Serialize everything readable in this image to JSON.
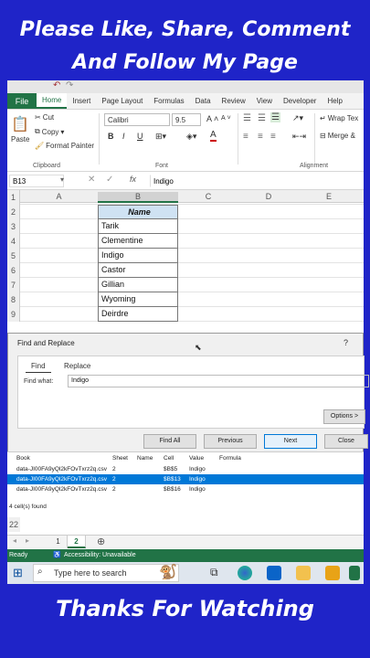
{
  "banner": {
    "line1": "Please Like, Share, Comment",
    "line2": "And Follow My Page",
    "bottom": "Thanks For Watching"
  },
  "ribbon": {
    "tabs": [
      "File",
      "Home",
      "Insert",
      "Page Layout",
      "Formulas",
      "Data",
      "Review",
      "View",
      "Developer",
      "Help"
    ],
    "clipboard": {
      "paste": "Paste",
      "cut": "Cut",
      "copy": "Copy",
      "format_painter": "Format Painter",
      "label": "Clipboard"
    },
    "font": {
      "name": "Calibri",
      "size": "9.5",
      "grow": "A",
      "shrink": "A",
      "bold": "B",
      "italic": "I",
      "underline": "U",
      "label": "Font"
    },
    "alignment": {
      "wrap": "Wrap Tex",
      "merge": "Merge &",
      "label": "Alignment"
    }
  },
  "formula_bar": {
    "name_box": "B13",
    "fx": "fx",
    "value": "Indigo"
  },
  "columns": [
    "A",
    "B",
    "C",
    "D",
    "E"
  ],
  "rows": [
    {
      "num": "1",
      "b": ""
    },
    {
      "num": "2",
      "b": "Name"
    },
    {
      "num": "3",
      "b": "Tarik"
    },
    {
      "num": "4",
      "b": "Clementine"
    },
    {
      "num": "5",
      "b": "Indigo"
    },
    {
      "num": "6",
      "b": "Castor"
    },
    {
      "num": "7",
      "b": "Gillian"
    },
    {
      "num": "8",
      "b": "Wyoming"
    },
    {
      "num": "9",
      "b": "Deirdre"
    }
  ],
  "dialog": {
    "title": "Find and Replace",
    "help": "?",
    "tab_find": "Find",
    "tab_replace": "Replace",
    "find_label": "Find what:",
    "find_value": "Indigo",
    "options": "Options >",
    "find_all": "Find All",
    "previous": "Previous",
    "next": "Next",
    "close": "Close"
  },
  "results": {
    "headers": [
      "Book",
      "Sheet",
      "Name",
      "Cell",
      "Value",
      "Formula"
    ],
    "rows": [
      [
        "data-JI00FA9yQl2kFOvTxrz2q.csv",
        "2",
        "",
        "$B$5",
        "Indigo",
        ""
      ],
      [
        "data-JI00FA9yQl2kFOvTxrz2q.csv",
        "2",
        "",
        "$B$13",
        "Indigo",
        ""
      ],
      [
        "data-JI00FA9yQl2kFOvTxrz2q.csv",
        "2",
        "",
        "$B$16",
        "Indigo",
        ""
      ]
    ],
    "status": "4 cell(s) found",
    "row22": "22"
  },
  "sheets": [
    "1",
    "2"
  ],
  "status_bar": {
    "ready": "Ready",
    "accessibility": "Accessibility: Unavailable"
  },
  "taskbar": {
    "search_placeholder": "Type here to search"
  },
  "colors": {
    "excel_green": "#217346",
    "banner_blue": "#1f24c8",
    "select_blue": "#0078d7"
  }
}
